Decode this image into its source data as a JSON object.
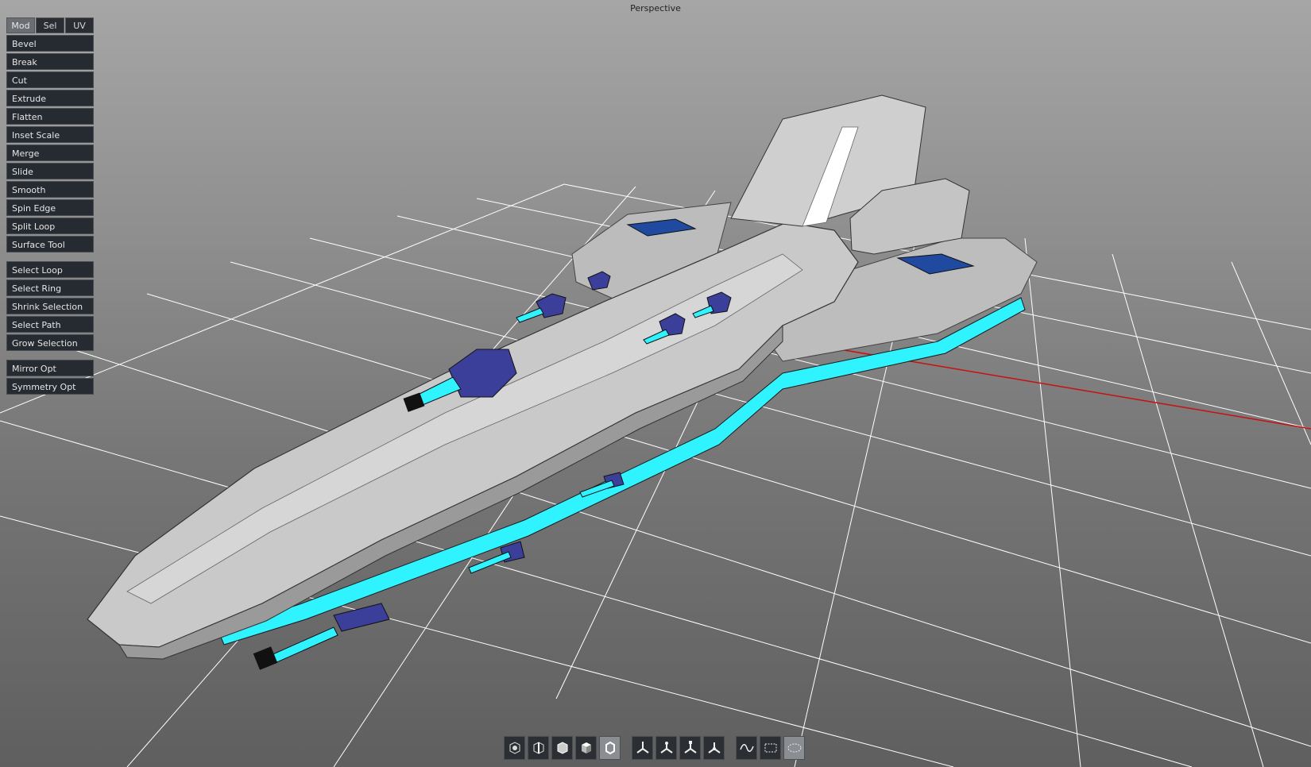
{
  "viewport": {
    "label": "Perspective"
  },
  "panel": {
    "tabs": [
      {
        "label": "Mod",
        "active": true
      },
      {
        "label": "Sel",
        "active": false
      },
      {
        "label": "UV",
        "active": false
      }
    ],
    "modify_tools": [
      "Bevel",
      "Break",
      "Cut",
      "Extrude",
      "Flatten",
      "Inset Scale",
      "Merge",
      "Slide",
      "Smooth",
      "Spin Edge",
      "Split Loop",
      "Surface Tool"
    ],
    "select_tools": [
      "Select Loop",
      "Select Ring",
      "Shrink Selection",
      "Select Path",
      "Grow Selection"
    ],
    "option_tools": [
      "Mirror Opt",
      "Symmetry Opt"
    ]
  },
  "toolbar": {
    "buttons": [
      {
        "icon": "vertex-mode-icon",
        "active": false
      },
      {
        "icon": "edge-mode-icon",
        "active": false
      },
      {
        "icon": "face-mode-icon",
        "active": false
      },
      {
        "icon": "object-mode-icon",
        "active": false
      },
      {
        "icon": "element-mode-icon",
        "active": true
      },
      {
        "icon": "move-gizmo-icon",
        "active": false
      },
      {
        "icon": "rotate-gizmo-icon",
        "active": false
      },
      {
        "icon": "scale-gizmo-icon",
        "active": false
      },
      {
        "icon": "universal-gizmo-icon",
        "active": false
      },
      {
        "icon": "lasso-select-icon",
        "active": false
      },
      {
        "icon": "box-select-icon",
        "active": false
      },
      {
        "icon": "paint-select-icon",
        "active": true
      }
    ]
  },
  "colors": {
    "grid": "#ffffff",
    "hull": "#c8c8c8",
    "glow": "#2ff3ff",
    "turret": "#3b3f9a",
    "x_axis": "#c81010",
    "panel_bg": "#262a31"
  }
}
